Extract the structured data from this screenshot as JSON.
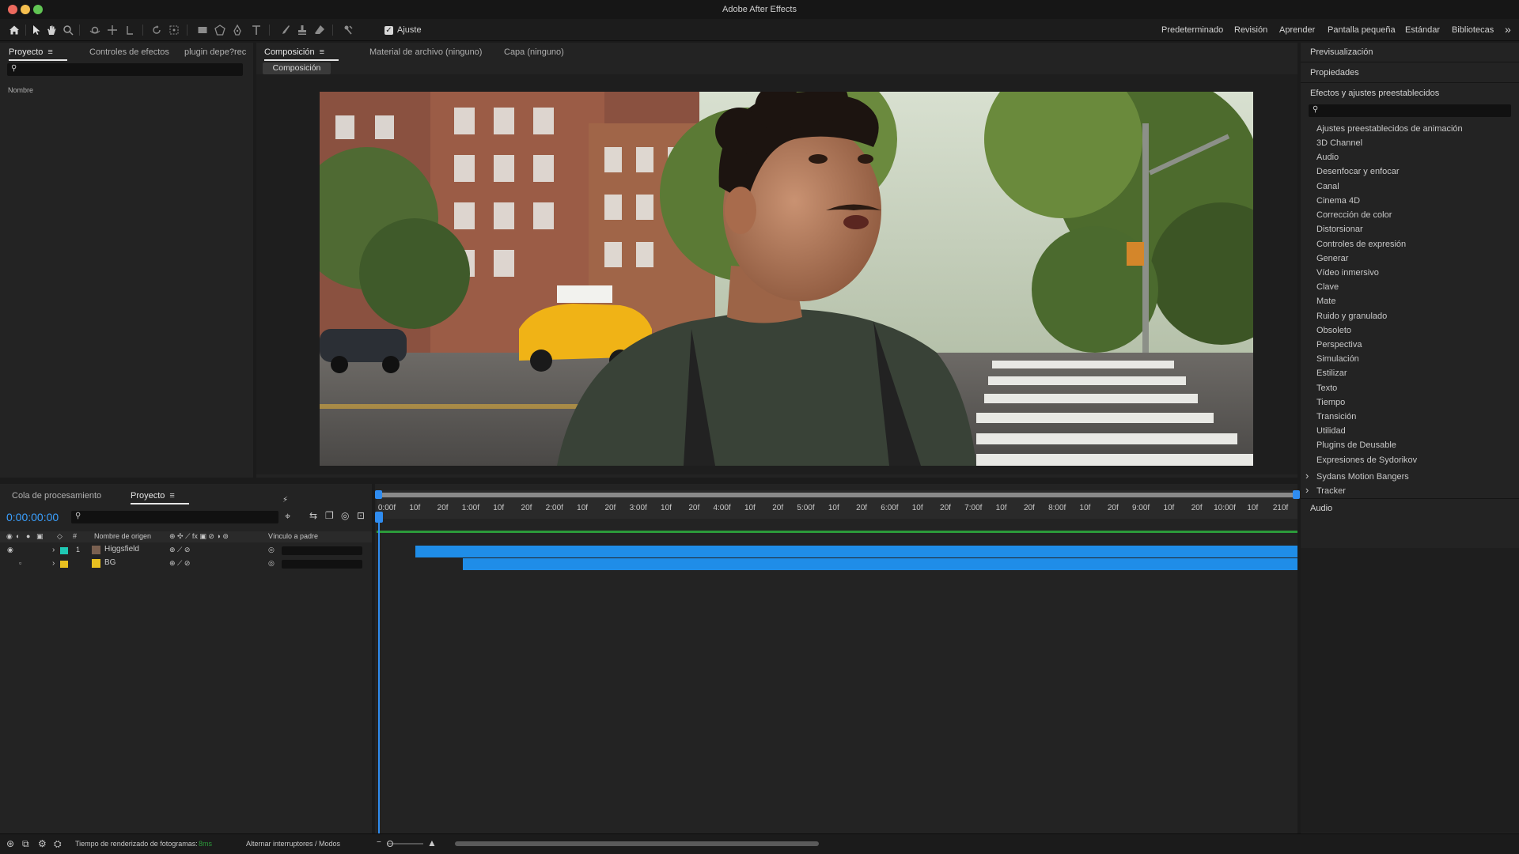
{
  "app": {
    "title": "Adobe After Effects"
  },
  "colors": {
    "accent_blue": "#2f8cf0",
    "layer_bar": "#1f8de8",
    "timecode": "#3aa0ff",
    "label_cyan": "#1fc8b4",
    "label_yellow": "#e8c020"
  },
  "toolbar": {
    "snap_label": "Ajuste",
    "workspaces": [
      "Predeterminado",
      "Revisión",
      "Aprender",
      "Pantalla pequeña",
      "Estándar",
      "Bibliotecas"
    ],
    "overflow": "»"
  },
  "project_panel": {
    "tabs": [
      "Proyecto",
      "Controles de efectos",
      "plugin depe?rec"
    ],
    "menu_glyph": "≡",
    "column_name": "Nombre"
  },
  "comp_panel": {
    "tabs": [
      "Composición",
      "Material de archivo (ninguno)",
      "Capa (ninguno)"
    ],
    "menu_glyph": "≡",
    "comp_pill": "Composición"
  },
  "right_panel": {
    "sections": [
      "Previsualización",
      "Propiedades",
      "Efectos y ajustes preestablecidos"
    ],
    "effects": [
      "Ajustes preestablecidos de animación",
      "3D Channel",
      "Audio",
      "Desenfocar y enfocar",
      "Canal",
      "Cinema 4D",
      "Corrección de color",
      "Distorsionar",
      "Controles de expresión",
      "Generar",
      "Vídeo inmersivo",
      "Clave",
      "Mate",
      "Ruido y granulado",
      "Obsoleto",
      "Perspectiva",
      "Simulación",
      "Estilizar",
      "Texto",
      "Tiempo",
      "Transición",
      "Utilidad",
      "Plugins de Deusable",
      "Expresiones de Sydorikov"
    ],
    "expandables": [
      "Sydans Motion Bangers",
      "Tracker"
    ],
    "chevron": "›",
    "bottom_section": "Audio"
  },
  "timeline": {
    "tabs": [
      "Cola de procesamiento",
      "Proyecto"
    ],
    "menu_glyph": "≡",
    "timecode": "0:00:00:00",
    "columns": {
      "source_name": "Nombre de origen",
      "parent": "Vínculo a padre"
    },
    "layers": [
      {
        "index": "1",
        "name": "Higgsfield",
        "label_color": "#1fc8b4",
        "bar_start_pct": 4.2,
        "bar_row": 0
      },
      {
        "index": "",
        "name": "BG",
        "label_color": "#e8c020",
        "bar_start_pct": 9.4,
        "bar_row": 1
      }
    ],
    "ticks": [
      "0:00f",
      "10f",
      "20f",
      "1:00f",
      "10f",
      "20f",
      "2:00f",
      "10f",
      "20f",
      "3:00f",
      "10f",
      "20f",
      "4:00f",
      "10f",
      "20f",
      "5:00f",
      "10f",
      "20f",
      "6:00f",
      "10f",
      "20f",
      "7:00f",
      "10f",
      "20f",
      "8:00f",
      "10f",
      "20f",
      "9:00f",
      "10f",
      "20f",
      "10:00f",
      "10f",
      "210f"
    ]
  },
  "status": {
    "render_label": "Tiempo de renderizado de fotogramas:",
    "render_value": "8ms",
    "toggle_label": "Alternar interruptores / Modos"
  }
}
